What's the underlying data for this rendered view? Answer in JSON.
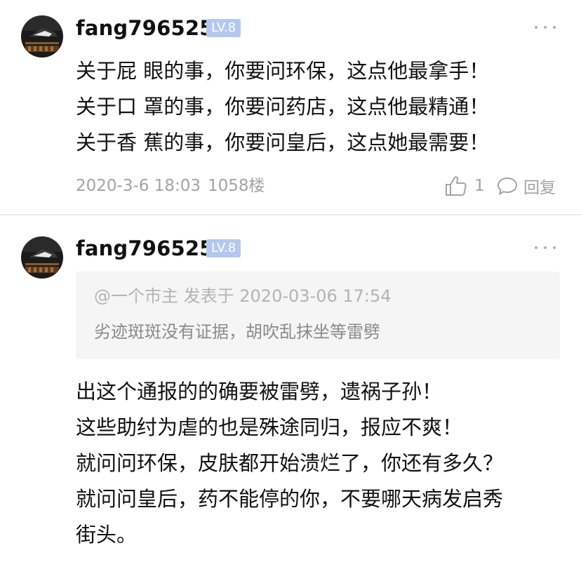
{
  "comments": [
    {
      "username": "fang796525",
      "level": "LV.8",
      "lines": [
        "关于屁 眼的事，你要问环保，这点他最拿手！",
        "关于口 罩的事，你要问药店，这点他最精通！",
        "关于香 蕉的事，你要问皇后，这点她最需要！"
      ],
      "datetime": "2020-3-6 18:03",
      "floor": "1058楼",
      "likes": "1",
      "reply_label": "回复"
    },
    {
      "username": "fang796525",
      "level": "LV.8",
      "quote": {
        "header": "@一个市主 发表于 2020-03-06 17:54",
        "text": "劣迹斑斑没有证据，胡吹乱抹坐等雷劈"
      },
      "lines": [
        "出这个通报的的确要被雷劈，遗祸子孙！",
        "这些助纣为虐的也是殊途同归，报应不爽！",
        "就问问环保，皮肤都开始溃烂了，你还有多久？",
        "就问问皇后，药不能停的你，不要哪天病发启秀",
        "街头。"
      ]
    }
  ],
  "colors": {
    "level_badge": "#b3c8ec",
    "meta_text": "#a3a3a3",
    "quote_bg": "#f5f5f5",
    "divider": "#ececec"
  },
  "icons": {
    "more": "more-dots-icon",
    "like": "thumbs-up-icon",
    "reply": "speech-bubble-icon"
  }
}
